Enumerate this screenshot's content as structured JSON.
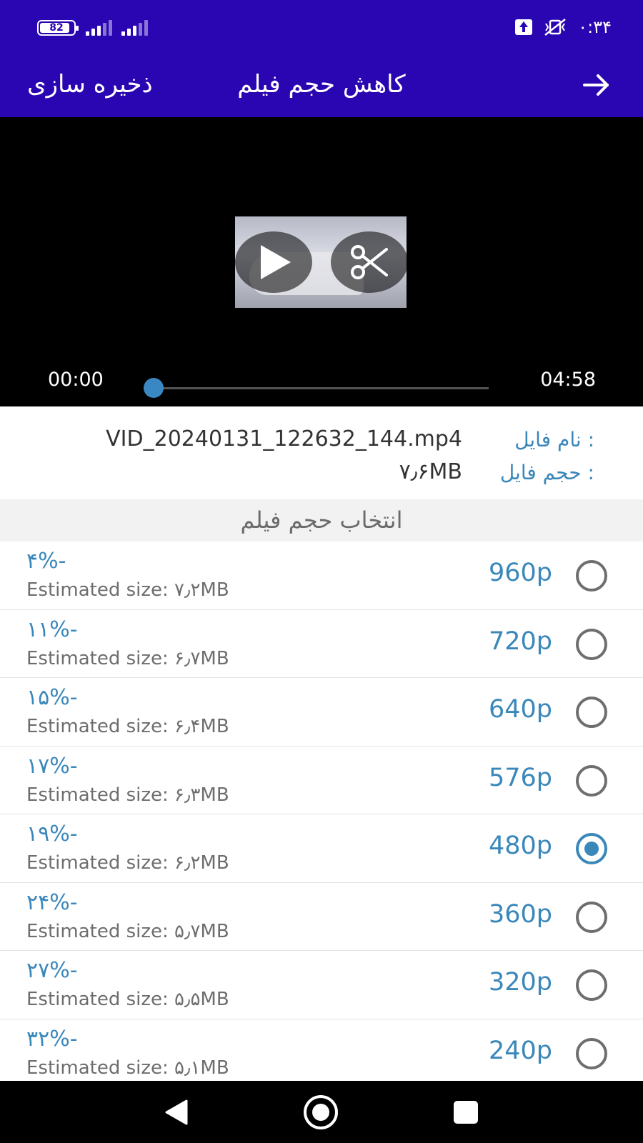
{
  "status_bar": {
    "battery": "82",
    "time": "۰:۳۴"
  },
  "app_bar": {
    "title": "کاهش حجم فیلم",
    "save_label": "ذخیره سازی"
  },
  "player": {
    "current_time": "00:00",
    "total_time": "04:58",
    "progress": 0
  },
  "file_info": {
    "name_label": ": نام فایل",
    "name_value": "VID_20240131_122632_144.mp4",
    "size_label": ": حجم فایل",
    "size_value": "۷٫۶MB"
  },
  "section_title": "انتخاب حجم فیلم",
  "options": [
    {
      "resolution": "960p",
      "percent": "۴%-",
      "estimate": "Estimated size: ۷٫۲MB",
      "selected": false
    },
    {
      "resolution": "720p",
      "percent": "۱۱%-",
      "estimate": "Estimated size: ۶٫۷MB",
      "selected": false
    },
    {
      "resolution": "640p",
      "percent": "۱۵%-",
      "estimate": "Estimated size: ۶٫۴MB",
      "selected": false
    },
    {
      "resolution": "576p",
      "percent": "۱۷%-",
      "estimate": "Estimated size: ۶٫۳MB",
      "selected": false
    },
    {
      "resolution": "480p",
      "percent": "۱۹%-",
      "estimate": "Estimated size: ۶٫۲MB",
      "selected": true
    },
    {
      "resolution": "360p",
      "percent": "۲۴%-",
      "estimate": "Estimated size: ۵٫۷MB",
      "selected": false
    },
    {
      "resolution": "320p",
      "percent": "۲۷%-",
      "estimate": "Estimated size: ۵٫۵MB",
      "selected": false
    },
    {
      "resolution": "240p",
      "percent": "۳۲%-",
      "estimate": "Estimated size: ۵٫۱MB",
      "selected": false
    }
  ],
  "colors": {
    "app_bar": "#2a05b2",
    "accent": "#3a87ba"
  }
}
